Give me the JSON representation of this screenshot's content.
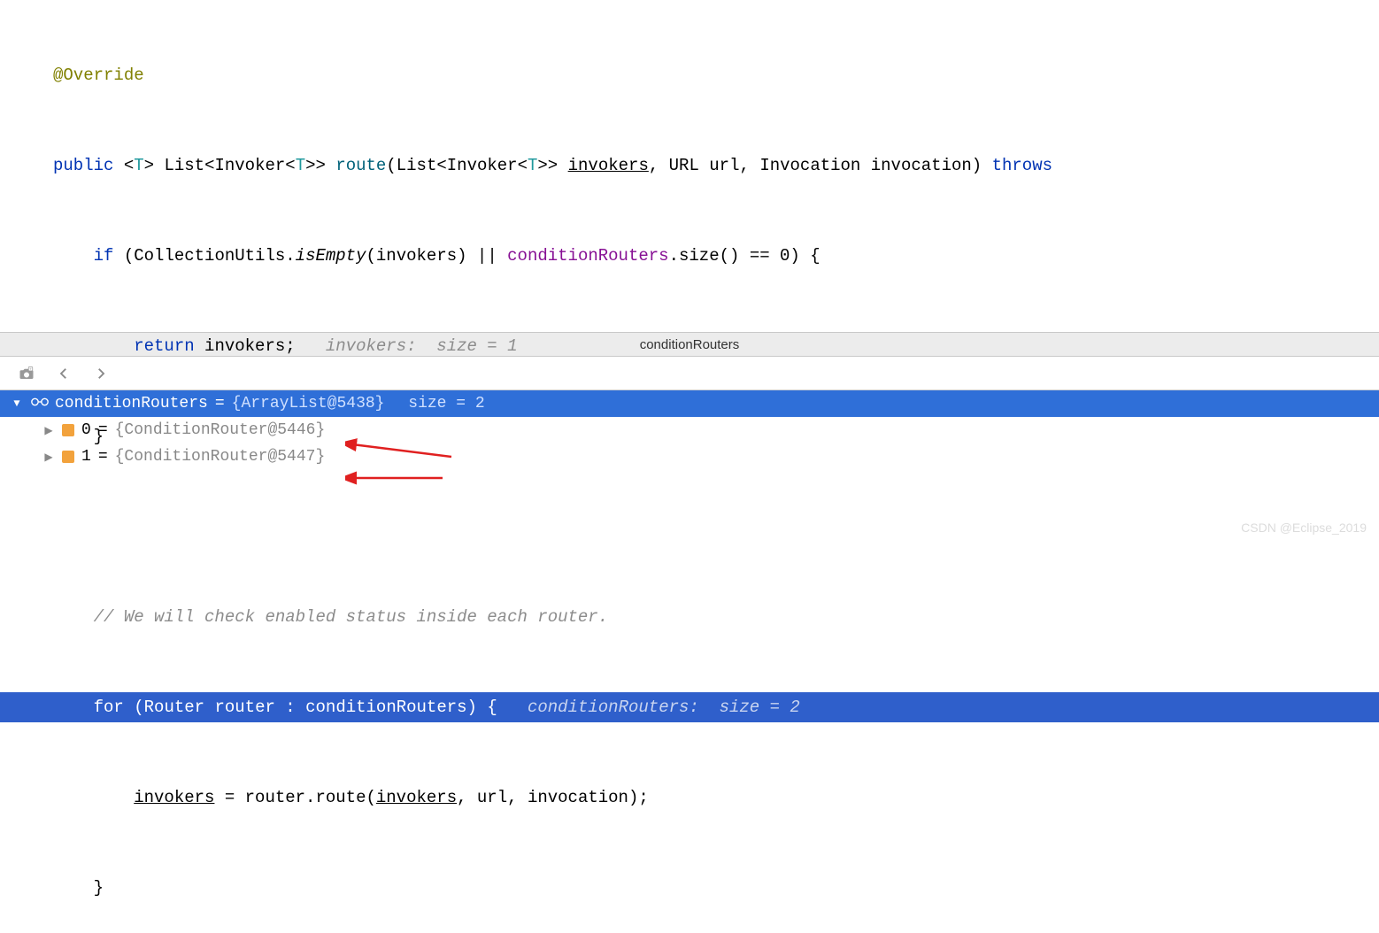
{
  "code": {
    "annotation": "@Override",
    "public": "public",
    "generic_open": "<",
    "T": "T",
    "generic_close": ">",
    "List": "List",
    "Invoker": "Invoker",
    "route": "route",
    "invokers": "invokers",
    "URL": "URL",
    "url": "url",
    "Invocation": "Invocation",
    "invocation": "invocation",
    "throws": "throws",
    "if": "if",
    "CollectionUtils": "CollectionUtils",
    "isEmpty": "isEmpty",
    "conditionRouters": "conditionRouters",
    "size": "size",
    "eq0": "== 0) {",
    "return": "return",
    "hint_invokers": "invokers:  size = 1",
    "close_brace": "}",
    "comment1": "// We will check enabled status inside each router.",
    "for": "for",
    "Router": "Router",
    "router": "router",
    "hint_cond": "conditionRouters:  size = 2",
    "semicolon": ";",
    "assign_line": " = router.route(",
    "comma_sp": ", ",
    "close_paren_semi": ");"
  },
  "debug": {
    "header": "conditionRouters",
    "root": {
      "name": "conditionRouters",
      "value": "{ArrayList@5438}",
      "size_label": "size = 2"
    },
    "children": [
      {
        "idx": "0",
        "value": "{ConditionRouter@5446}"
      },
      {
        "idx": "1",
        "value": "{ConditionRouter@5447}"
      }
    ]
  },
  "watermark": "CSDN @Eclipse_2019"
}
